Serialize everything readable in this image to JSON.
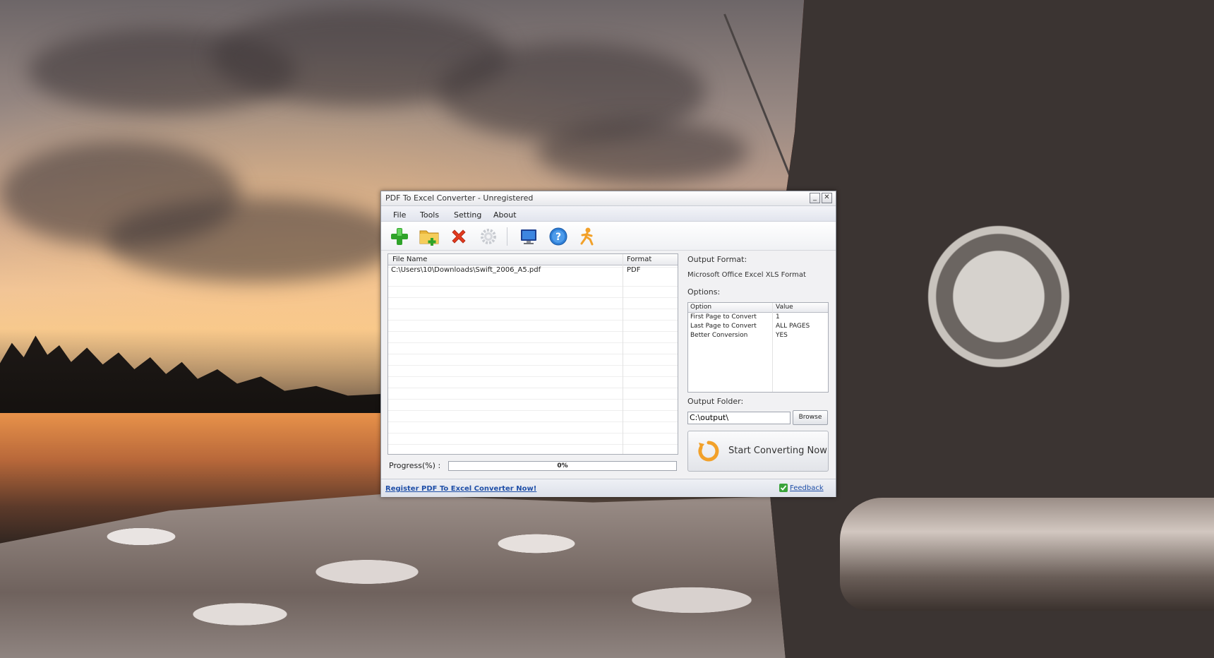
{
  "window": {
    "title": "PDF To Excel Converter - Unregistered",
    "minimize_label": "_",
    "close_label": "✕"
  },
  "menu": {
    "items": [
      "File",
      "Tools",
      "Setting",
      "About"
    ]
  },
  "toolbar": {
    "icons": [
      "add-file-icon",
      "add-folder-icon",
      "delete-icon",
      "settings-icon",
      "monitor-icon",
      "help-icon",
      "run-icon"
    ]
  },
  "file_list": {
    "columns": [
      "File Name",
      "Format"
    ],
    "rows": [
      {
        "file_name": "C:\\Users\\10\\Downloads\\Swift_2006_A5.pdf",
        "format": "PDF"
      }
    ]
  },
  "progress": {
    "label": "Progress(%)   :",
    "value_text": "0%",
    "value": 0
  },
  "output_format": {
    "label": "Output Format:",
    "value": "Microsoft Office Excel XLS Format"
  },
  "options": {
    "label": "Options:",
    "columns": [
      "Option",
      "Value"
    ],
    "rows": [
      {
        "option": "First Page to Convert",
        "value": "1"
      },
      {
        "option": "Last Page to Convert",
        "value": "ALL PAGES"
      },
      {
        "option": "Better Conversion",
        "value": "YES"
      }
    ]
  },
  "output_folder": {
    "label": "Output Folder:",
    "value": "C:\\output\\",
    "browse_label": "Browse"
  },
  "start_button": {
    "label": "Start Converting Now"
  },
  "statusbar": {
    "register_link": "Register PDF To Excel Converter Now!",
    "feedback_link": "Feedback"
  },
  "colors": {
    "link": "#1f4fa8",
    "add_green": "#2fa32a",
    "delete_red": "#e23a1f",
    "help_blue": "#2f7fd6",
    "accent_orange": "#f2a12a"
  }
}
